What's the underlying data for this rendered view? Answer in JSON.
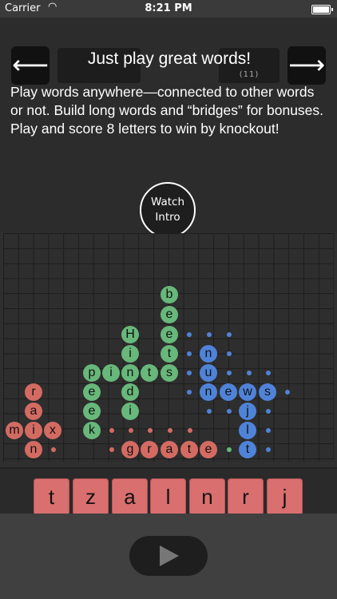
{
  "status_bar": {
    "carrier": "Carrier",
    "time": "8:21 PM"
  },
  "header": {
    "title": "Just play great words!",
    "back_arrow": "🡐",
    "next_arrow": "🡒",
    "score_sub": "(11)"
  },
  "instructions": "Play words anywhere—connected to other words or not. Build long words and “bridges” for bonuses. Play and score 8 letters to win by knockout!",
  "watch_button": {
    "line1": "Watch",
    "line2": "Intro"
  },
  "colors": {
    "green": "#67b87a",
    "blue": "#4f83d8",
    "red": "#d36b63"
  },
  "board_tiles": [
    {
      "l": "b",
      "c": "g"
    },
    {
      "l": "e",
      "c": "g"
    },
    {
      "l": "e",
      "c": "g"
    },
    {
      "l": "t",
      "c": "g"
    },
    {
      "l": "s",
      "c": "g"
    },
    {
      "l": "H",
      "c": "g"
    },
    {
      "l": "i",
      "c": "g"
    },
    {
      "l": "n",
      "c": "g"
    },
    {
      "l": "d",
      "c": "g"
    },
    {
      "l": "i",
      "c": "g"
    },
    {
      "l": "p",
      "c": "g"
    },
    {
      "l": "i",
      "c": "g"
    },
    {
      "l": "n",
      "c": "g"
    },
    {
      "l": "t",
      "c": "g"
    },
    {
      "l": "e",
      "c": "g"
    },
    {
      "l": "e",
      "c": "g"
    },
    {
      "l": "k",
      "c": "g"
    },
    {
      "l": "n",
      "c": "b"
    },
    {
      "l": "u",
      "c": "b"
    },
    {
      "l": "n",
      "c": "b"
    },
    {
      "l": "e",
      "c": "b"
    },
    {
      "l": "w",
      "c": "b"
    },
    {
      "l": "s",
      "c": "b"
    },
    {
      "l": "j",
      "c": "b"
    },
    {
      "l": "i",
      "c": "b"
    },
    {
      "l": "l",
      "c": "b"
    },
    {
      "l": "t",
      "c": "b"
    },
    {
      "l": "r",
      "c": "r"
    },
    {
      "l": "a",
      "c": "r"
    },
    {
      "l": "m",
      "c": "r"
    },
    {
      "l": "i",
      "c": "r"
    },
    {
      "l": "x",
      "c": "r"
    },
    {
      "l": "n",
      "c": "r"
    },
    {
      "l": "g",
      "c": "r"
    },
    {
      "l": "r",
      "c": "r"
    },
    {
      "l": "a",
      "c": "r"
    },
    {
      "l": "t",
      "c": "r"
    },
    {
      "l": "e",
      "c": "r"
    }
  ],
  "rack_letters": [
    "t",
    "z",
    "a",
    "l",
    "n",
    "r",
    "j"
  ],
  "play_icon": "play-icon"
}
